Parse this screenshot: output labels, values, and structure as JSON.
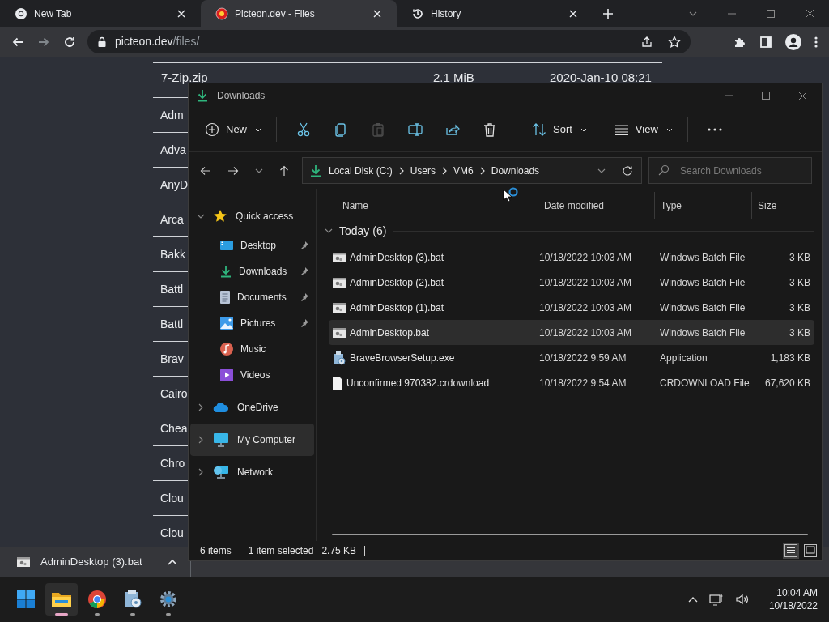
{
  "browser": {
    "tabs": [
      {
        "title": "New Tab",
        "kind": "chrome",
        "selected": false
      },
      {
        "title": "Picteon.dev - Files",
        "kind": "site",
        "selected": true
      },
      {
        "title": "History",
        "kind": "history",
        "selected": false
      }
    ],
    "address": {
      "host": "picteon.dev",
      "path": "/files/"
    }
  },
  "page": {
    "first_row": {
      "name": "7-Zip.zip",
      "size": "2.1 MiB",
      "date": "2020-Jan-10 08:21"
    },
    "names": [
      "Adm",
      "Adva",
      "AnyD",
      "Arca",
      "Bakk",
      "Battl",
      "Battl",
      "Brav",
      "Cairo",
      "Chea",
      "Chro",
      "Clou",
      "Clou"
    ]
  },
  "download_bar": {
    "file": "AdminDesktop (3).bat"
  },
  "explorer": {
    "title": "Downloads",
    "commands": [
      {
        "kind": "new",
        "label": "New",
        "disabled": false
      },
      {
        "kind": "cut",
        "disabled": false
      },
      {
        "kind": "copy",
        "disabled": false
      },
      {
        "kind": "paste",
        "disabled": true
      },
      {
        "kind": "rename",
        "disabled": false
      },
      {
        "kind": "share",
        "disabled": false
      },
      {
        "kind": "delete",
        "disabled": false
      },
      {
        "kind": "sort",
        "label": "Sort",
        "disabled": false
      },
      {
        "kind": "view",
        "label": "View",
        "disabled": false
      },
      {
        "kind": "more",
        "disabled": false
      }
    ],
    "breadcrumb": [
      "Local Disk (C:)",
      "Users",
      "VM6",
      "Downloads"
    ],
    "search": {
      "placeholder": "Search Downloads"
    },
    "nav": [
      {
        "label": "Quick access",
        "kind": "star",
        "expanded": true,
        "selected": false,
        "children": [
          {
            "label": "Desktop",
            "kind": "desktop",
            "pinned": true,
            "selected": false
          },
          {
            "label": "Downloads",
            "kind": "download",
            "pinned": true,
            "selected": false
          },
          {
            "label": "Documents",
            "kind": "document",
            "pinned": true,
            "selected": false
          },
          {
            "label": "Pictures",
            "kind": "pictures",
            "pinned": true,
            "selected": false
          },
          {
            "label": "Music",
            "kind": "music",
            "pinned": false,
            "selected": false
          },
          {
            "label": "Videos",
            "kind": "videos",
            "pinned": false,
            "selected": false
          }
        ]
      },
      {
        "label": "OneDrive",
        "kind": "cloud",
        "expanded": false,
        "selected": false
      },
      {
        "label": "My Computer",
        "kind": "computer",
        "expanded": false,
        "selected": true
      },
      {
        "label": "Network",
        "kind": "network",
        "expanded": false,
        "selected": false
      }
    ],
    "columns": [
      "Name",
      "Date modified",
      "Type",
      "Size"
    ],
    "group": {
      "label": "Today (6)",
      "expanded": true
    },
    "files": [
      {
        "name": "AdminDesktop (3).bat",
        "kind": "bat",
        "date": "10/18/2022 10:03 AM",
        "type": "Windows Batch File",
        "size": "3 KB",
        "selected": false
      },
      {
        "name": "AdminDesktop (2).bat",
        "kind": "bat",
        "date": "10/18/2022 10:03 AM",
        "type": "Windows Batch File",
        "size": "3 KB",
        "selected": false
      },
      {
        "name": "AdminDesktop (1).bat",
        "kind": "bat",
        "date": "10/18/2022 10:03 AM",
        "type": "Windows Batch File",
        "size": "3 KB",
        "selected": false
      },
      {
        "name": "AdminDesktop.bat",
        "kind": "bat",
        "date": "10/18/2022 10:03 AM",
        "type": "Windows Batch File",
        "size": "3 KB",
        "selected": true
      },
      {
        "name": "BraveBrowserSetup.exe",
        "kind": "exe",
        "date": "10/18/2022 9:59 AM",
        "type": "Application",
        "size": "1,183 KB",
        "selected": false
      },
      {
        "name": "Unconfirmed 970382.crdownload",
        "kind": "blank",
        "date": "10/18/2022 9:54 AM",
        "type": "CRDOWNLOAD File",
        "size": "67,620 KB",
        "selected": false
      }
    ],
    "status": {
      "count": "6 items",
      "selection": "1 item selected",
      "size": "2.75 KB"
    },
    "view_modes": [
      {
        "kind": "details",
        "selected": true
      },
      {
        "kind": "tiles",
        "selected": false
      }
    ]
  },
  "taskbar": {
    "apps": [
      {
        "kind": "start",
        "running": false,
        "active": false
      },
      {
        "kind": "explorer",
        "running": true,
        "active": true
      },
      {
        "kind": "chrome",
        "running": true,
        "active": false
      },
      {
        "kind": "installer",
        "running": true,
        "active": false
      },
      {
        "kind": "settings",
        "running": true,
        "active": false
      }
    ],
    "time": "10:04 AM",
    "date": "10/18/2022"
  }
}
